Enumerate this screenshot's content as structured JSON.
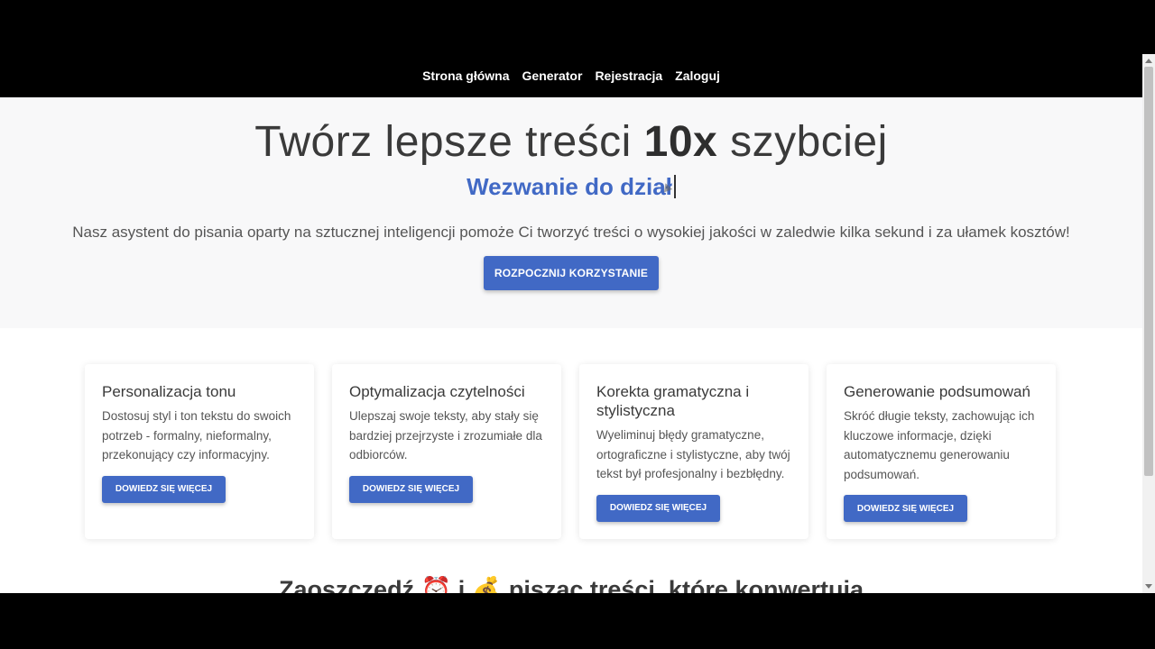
{
  "nav": {
    "items": [
      "Strona główna",
      "Generator",
      "Rejestracja",
      "Zaloguj"
    ]
  },
  "hero": {
    "title_before": "Twórz lepsze treści ",
    "title_bold": "10x",
    "title_after": " szybciej",
    "typed_text": "Wezwanie do dział",
    "description": "Nasz asystent do pisania oparty na sztucznej inteligencji pomoże Ci tworzyć treści o wysokiej jakości w zaledwie kilka sekund i za ułamek kosztów!",
    "cta_label": "ROZPOCZNIJ KORZYSTANIE"
  },
  "cards": [
    {
      "title": "Personalizacja tonu",
      "text": "Dostosuj styl i ton tekstu do swoich potrzeb - formalny, nieformalny, przekonujący czy informacyjny.",
      "button": "DOWIEDZ SIĘ WIĘCEJ"
    },
    {
      "title": "Optymalizacja czytelności",
      "text": "Ulepszaj swoje teksty, aby stały się bardziej przejrzyste i zrozumiałe dla odbiorców.",
      "button": "DOWIEDZ SIĘ WIĘCEJ"
    },
    {
      "title": "Korekta gramatyczna i stylistyczna",
      "text": "Wyeliminuj błędy gramatyczne, ortograficzne i stylistyczne, aby twój tekst był profesjonalny i bezbłędny.",
      "button": "DOWIEDZ SIĘ WIĘCEJ"
    },
    {
      "title": "Generowanie podsumowań",
      "text": "Skróć długie teksty, zachowując ich kluczowe informacje, dzięki automatycznemu generowaniu podsumowań.",
      "button": "DOWIEDZ SIĘ WIĘCEJ"
    }
  ],
  "section": {
    "before": "Zaoszczędź ",
    "emoji_time": "⏰",
    "middle": " i ",
    "emoji_money": "💰",
    "after_normal": " pisząc treści, które ",
    "after_bold": "konwertują"
  },
  "colors": {
    "accent": "#4169c5",
    "navbar": "#000000",
    "hero_bg": "#f8f8f9"
  }
}
